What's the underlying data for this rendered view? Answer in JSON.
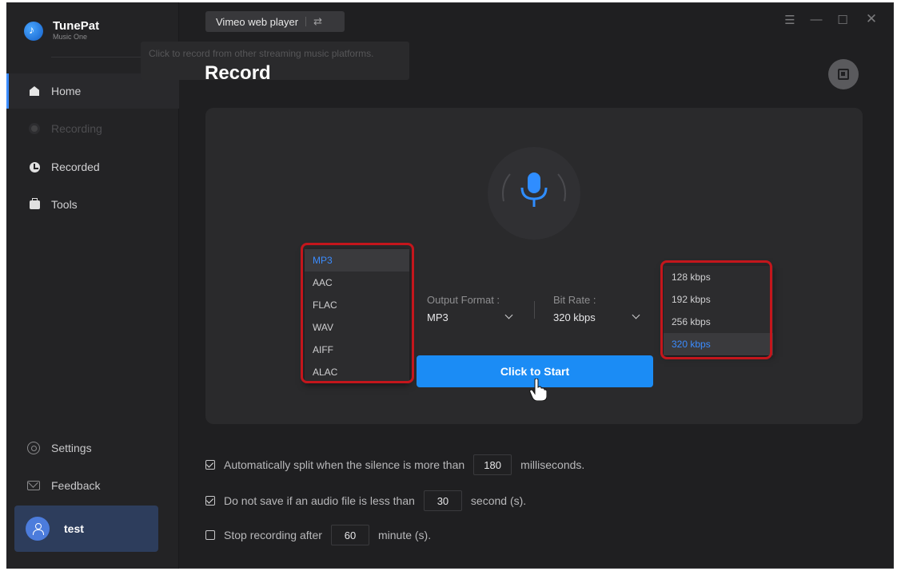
{
  "brand": {
    "name": "TunePat",
    "sub": "Music One"
  },
  "sidebar": {
    "items": [
      {
        "label": "Home",
        "icon": "home-icon",
        "active": true
      },
      {
        "label": "Recording",
        "icon": "record-icon",
        "disabled": true
      },
      {
        "label": "Recorded",
        "icon": "clock-icon"
      },
      {
        "label": "Tools",
        "icon": "toolbox-icon"
      }
    ],
    "settings_label": "Settings",
    "feedback_label": "Feedback",
    "user": {
      "name": "test"
    }
  },
  "header": {
    "source_label": "Vimeo web player",
    "tooltip": "Click to record from other streaming music platforms."
  },
  "main": {
    "title": "Record",
    "output_format": {
      "label": "Output Format :",
      "value": "MP3"
    },
    "bit_rate": {
      "label": "Bit Rate :",
      "value": "320 kbps"
    },
    "format_options": [
      "MP3",
      "AAC",
      "FLAC",
      "WAV",
      "AIFF",
      "ALAC"
    ],
    "bitrate_options": [
      "128 kbps",
      "192 kbps",
      "256 kbps",
      "320 kbps"
    ],
    "start_button": "Click to Start"
  },
  "options": [
    {
      "checked": true,
      "before": "Automatically split when the silence is more than",
      "value": "180",
      "after": "milliseconds."
    },
    {
      "checked": true,
      "before": "Do not save if an audio file is less than",
      "value": "30",
      "after": "second (s)."
    },
    {
      "checked": false,
      "before": "Stop recording after",
      "value": "60",
      "after": "minute (s)."
    }
  ],
  "colors": {
    "accent": "#1b8cf5",
    "highlight_box": "#c4161c",
    "background": "#1f1f21"
  }
}
